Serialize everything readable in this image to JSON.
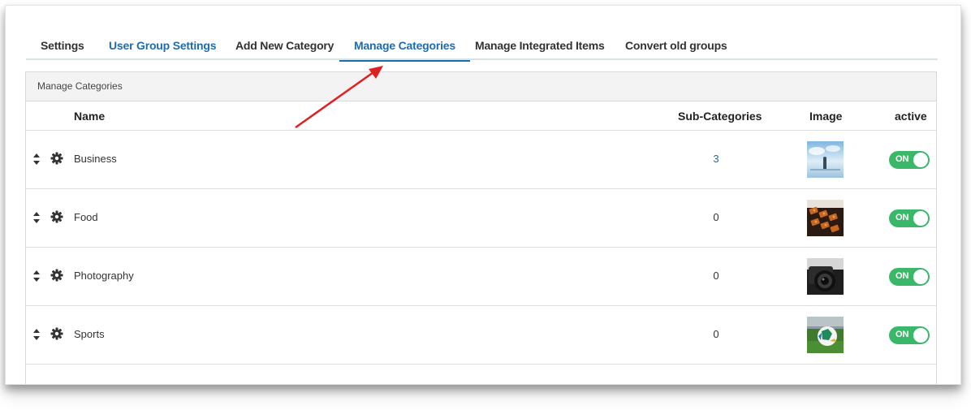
{
  "tabs": [
    {
      "label": "Settings",
      "state": "default"
    },
    {
      "label": "User Group Settings",
      "state": "highlight"
    },
    {
      "label": "Add New Category",
      "state": "default"
    },
    {
      "label": "Manage Categories",
      "state": "active"
    },
    {
      "label": "Manage Integrated Items",
      "state": "default"
    },
    {
      "label": "Convert old groups",
      "state": "default"
    }
  ],
  "panel": {
    "title": "Manage Categories",
    "columns": {
      "name": "Name",
      "subcategories": "Sub-Categories",
      "image": "Image",
      "active": "active"
    },
    "rows": [
      {
        "name": "Business",
        "subcategories": "3",
        "image": "business-image",
        "active_label": "ON"
      },
      {
        "name": "Food",
        "subcategories": "0",
        "image": "food-image",
        "active_label": "ON"
      },
      {
        "name": "Photography",
        "subcategories": "0",
        "image": "photography-image",
        "active_label": "ON"
      },
      {
        "name": "Sports",
        "subcategories": "0",
        "image": "sports-image",
        "active_label": "ON"
      }
    ]
  },
  "colors": {
    "accent": "#1f6bb0",
    "toggle_on": "#3ab869",
    "annotation_arrow": "#e02020"
  },
  "icons": {
    "sort": "sort-icon",
    "settings": "gear-icon"
  }
}
